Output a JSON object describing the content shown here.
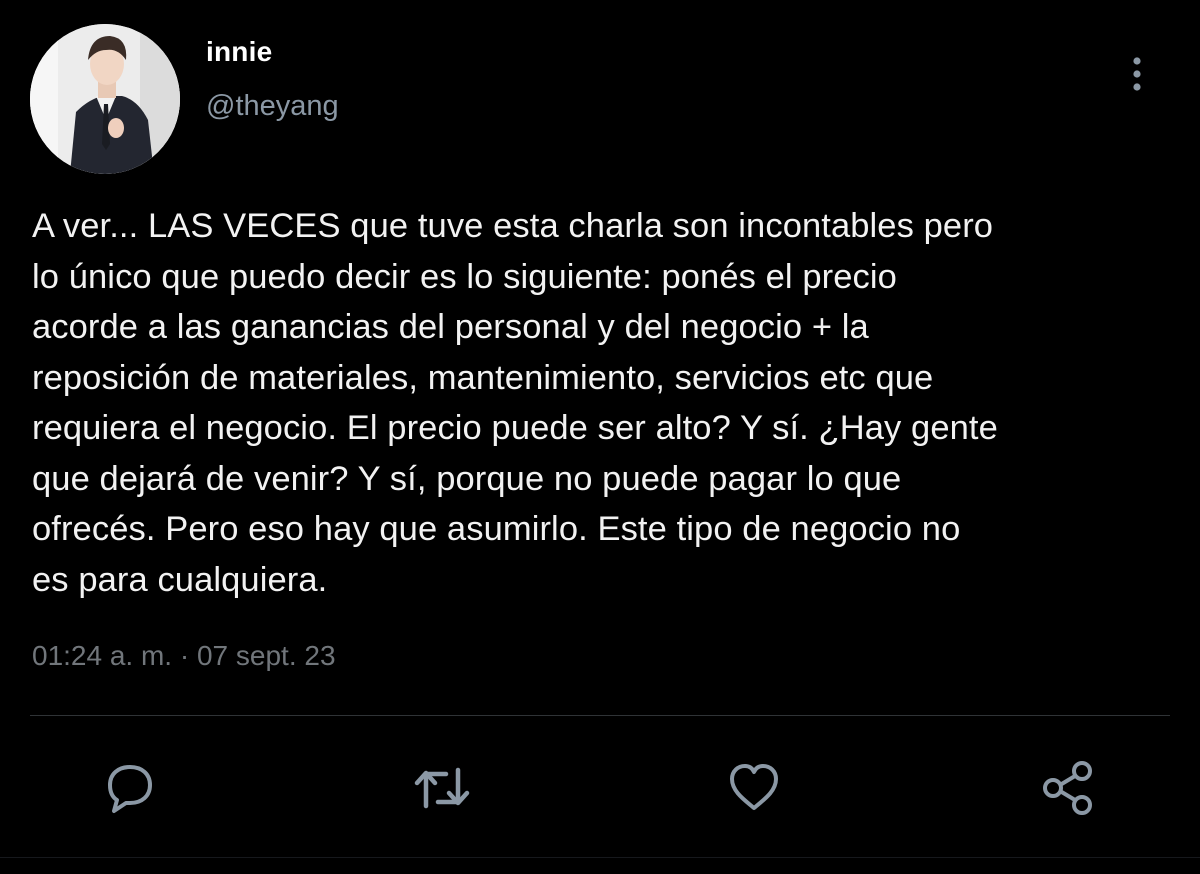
{
  "user": {
    "display_name": "innie",
    "handle": "@theyang",
    "avatar_icon": "profile-photo"
  },
  "tweet": {
    "text": "A ver... LAS VECES que tuve esta charla son incontables pero\nlo único que puedo decir es lo siguiente: ponés el precio\nacorde a las ganancias del personal y del negocio + la\nreposición de materiales, mantenimiento, servicios etc que\nrequiera el negocio. El precio puede ser alto? Y sí. ¿Hay gente\nque dejará de venir? Y sí, porque no puede pagar lo que\nofrecés. Pero eso hay que asumirlo. Este tipo de negocio no\nes para cualquiera.",
    "timestamp": "01:24 a. m. · 07 sept. 23"
  },
  "actions": {
    "reply_icon": "speech-bubble-icon",
    "retweet_icon": "retweet-icon",
    "like_icon": "heart-icon",
    "share_icon": "share-icon",
    "more_icon": "vertical-ellipsis-icon"
  },
  "colors": {
    "background": "#000000",
    "primary_text": "#e7e9ea",
    "secondary_text": "#71767b",
    "icon": "#8b98a5",
    "divider": "#2f3336"
  }
}
